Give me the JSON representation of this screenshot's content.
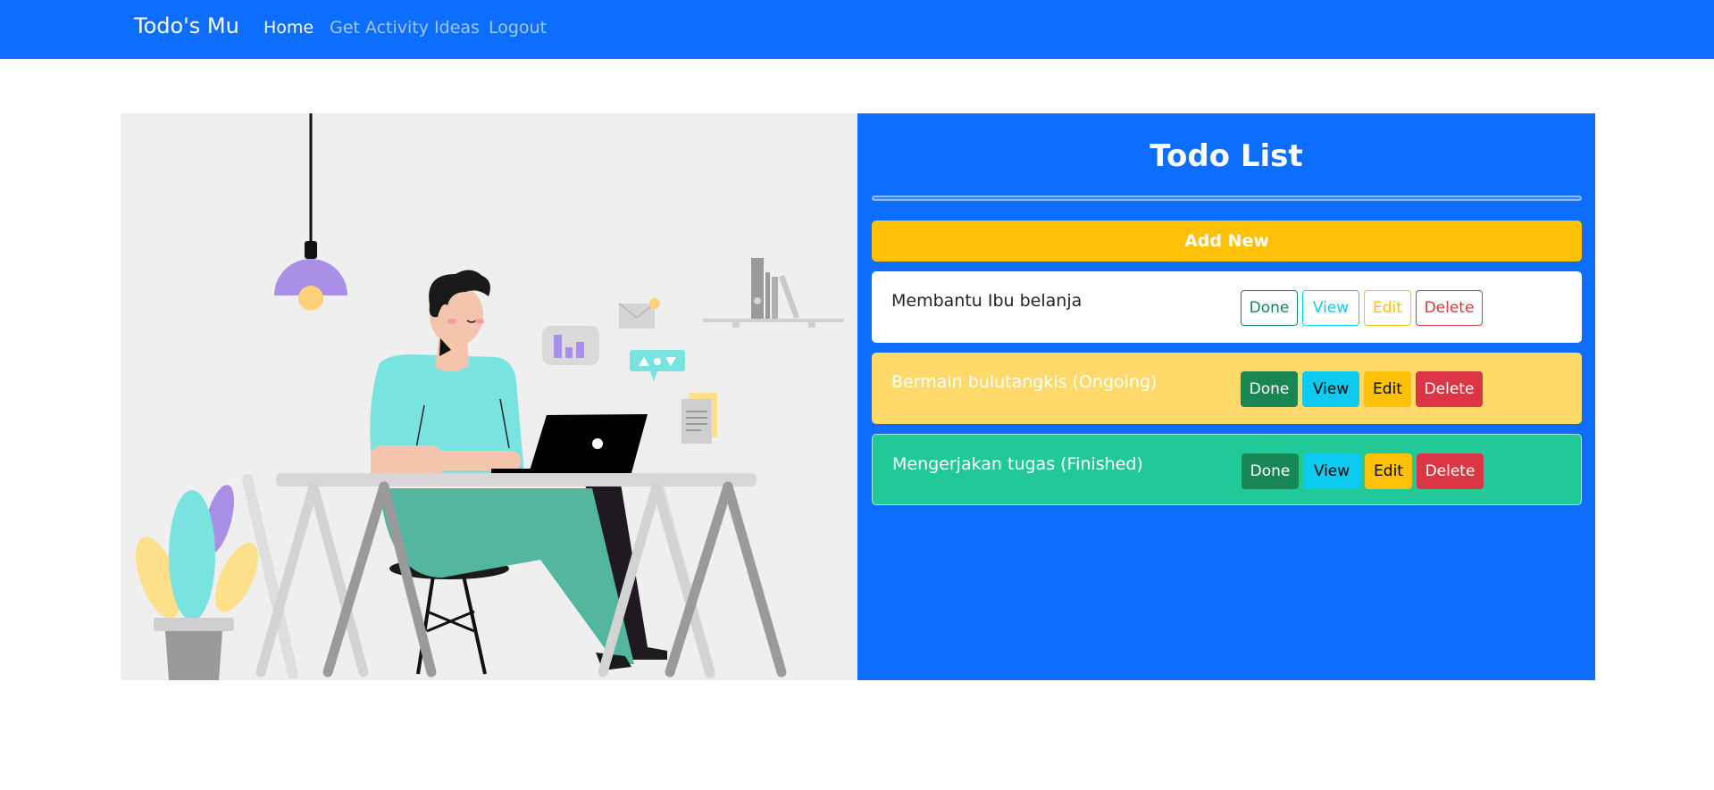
{
  "navbar": {
    "brand": "Todo's Mu",
    "links": [
      {
        "label": "Home",
        "active": true
      },
      {
        "label": "Get Activity Ideas",
        "active": false
      },
      {
        "label": "Logout",
        "active": false
      }
    ],
    "color": "#0d6efd"
  },
  "illustration": {
    "subject": "person-working-on-laptop-illustration"
  },
  "todo_panel": {
    "title": "Todo List",
    "add_button": "Add New",
    "items": [
      {
        "text": "Membantu Ibu belanja",
        "status": "pending",
        "bg": "#ffffff",
        "text_color": "#212529"
      },
      {
        "text": "Bermain bulutangkis (Ongoing)",
        "status": "ongoing",
        "bg": "#ffda6a",
        "text_color": "#ffffff"
      },
      {
        "text": "Mengerjakan tugas (Finished)",
        "status": "finished",
        "bg": "#20c997",
        "text_color": "#ffffff"
      }
    ],
    "buttons": {
      "done": "Done",
      "view": "View",
      "edit": "Edit",
      "delete": "Delete"
    }
  },
  "colors": {
    "primary": "#0d6efd",
    "warning": "#ffc107",
    "success": "#198754",
    "info": "#0dcaf0",
    "danger": "#dc3545"
  }
}
